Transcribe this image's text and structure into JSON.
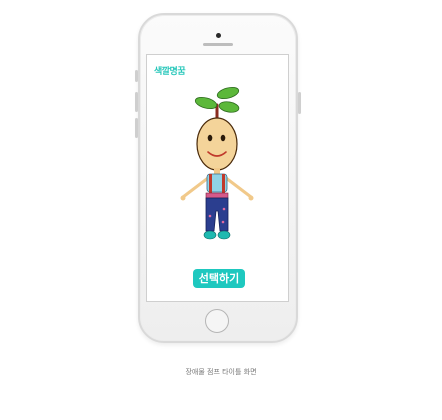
{
  "screen": {
    "logo_text": "색깔명꿈",
    "select_button_label": "선택하기"
  },
  "caption": "장애물 점프 타이틀 화면",
  "icons": [
    "sprout-icon",
    "character-illustration",
    "home-button"
  ],
  "colors": {
    "accent": "#1ec8bf",
    "logo": "#27c7ba",
    "leaf": "#5cb83a",
    "face": "#f4d49a",
    "jeans": "#2b3e8f",
    "shirt": "#8fd3e6"
  }
}
